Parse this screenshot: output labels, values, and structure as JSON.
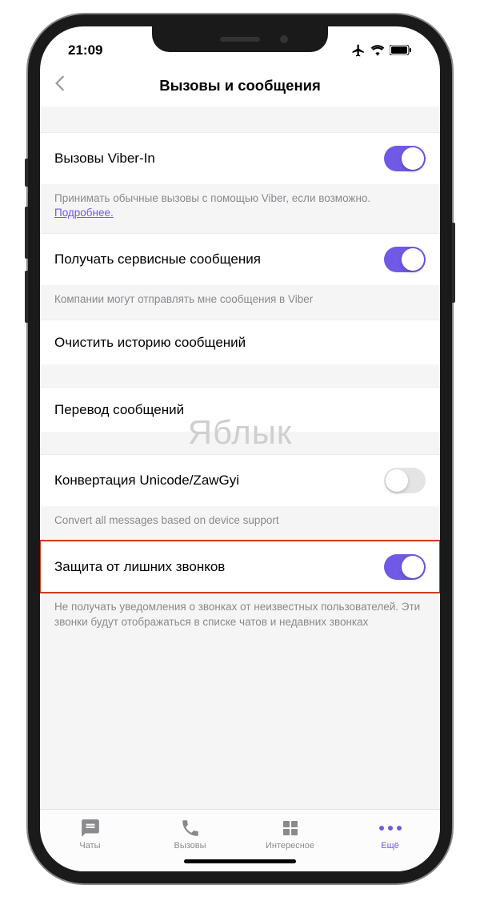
{
  "status": {
    "time": "21:09"
  },
  "header": {
    "title": "Вызовы и сообщения"
  },
  "watermark": "Яблык",
  "rows": {
    "viber_in": {
      "label": "Вызовы Viber-In",
      "desc_prefix": "Принимать обычные вызовы с помощью Viber, если возможно. ",
      "desc_link": "Подробнее."
    },
    "service_msgs": {
      "label": "Получать сервисные сообщения",
      "desc": "Компании могут отправлять мне сообщения в Viber"
    },
    "clear_history": {
      "label": "Очистить историю сообщений"
    },
    "translate": {
      "label": "Перевод сообщений"
    },
    "zawgyi": {
      "label": "Конвертация Unicode/ZawGyi",
      "desc": "Convert all messages based on device support"
    },
    "protect": {
      "label": "Защита от лишних звонков",
      "desc": "Не получать уведомления о звонках от неизвестных пользователей. Эти звонки будут отображаться в списке чатов и недавних звонках"
    }
  },
  "tabs": {
    "chats": "Чаты",
    "calls": "Вызовы",
    "explore": "Интересное",
    "more": "Ещё"
  }
}
